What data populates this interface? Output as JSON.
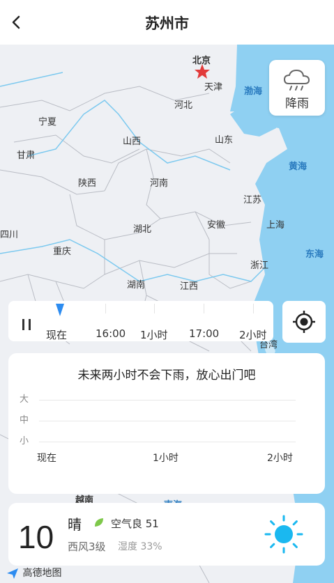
{
  "header": {
    "title": "苏州市",
    "back_icon": "chevron-left-icon"
  },
  "map": {
    "provinces": [
      {
        "name": "北京"
      },
      {
        "name": "天津"
      },
      {
        "name": "河北"
      },
      {
        "name": "宁夏"
      },
      {
        "name": "山西"
      },
      {
        "name": "山东"
      },
      {
        "name": "甘肃"
      },
      {
        "name": "陕西"
      },
      {
        "name": "河南"
      },
      {
        "name": "江苏"
      },
      {
        "name": "四川"
      },
      {
        "name": "湖北"
      },
      {
        "name": "安徽"
      },
      {
        "name": "上海"
      },
      {
        "name": "重庆"
      },
      {
        "name": "浙江"
      },
      {
        "name": "湖南"
      },
      {
        "name": "江西"
      },
      {
        "name": "台湾"
      },
      {
        "name": "越南"
      }
    ],
    "seas": [
      {
        "name": "渤海"
      },
      {
        "name": "黄海"
      },
      {
        "name": "东海"
      },
      {
        "name": "南海"
      }
    ],
    "capital_marker_color": "#e23b3b",
    "sea_color": "#8fd0f2",
    "land_color": "#f1f2f6"
  },
  "controls": {
    "rain_label": "降雨",
    "rain_icon": "cloud-rain-icon",
    "locate_icon": "crosshair-icon"
  },
  "timeline": {
    "labels": [
      "现在",
      "16:00",
      "1小时",
      "17:00",
      "2小时"
    ],
    "playing": false,
    "accent": "#2d8cf0"
  },
  "forecast": {
    "message": "未来两小时不会下雨，放心出门吧",
    "levels": [
      "大",
      "中",
      "小"
    ],
    "x_labels": [
      "现在",
      "1小时",
      "2小时"
    ]
  },
  "current": {
    "temperature": "10",
    "condition": "晴",
    "aqi_text": "空气良 51",
    "wind": "西风3级",
    "humidity": "湿度 33%",
    "sun_color": "#1ab8f0",
    "leaf_color": "#7ec84a"
  },
  "footer": {
    "logo": "高德地图"
  }
}
